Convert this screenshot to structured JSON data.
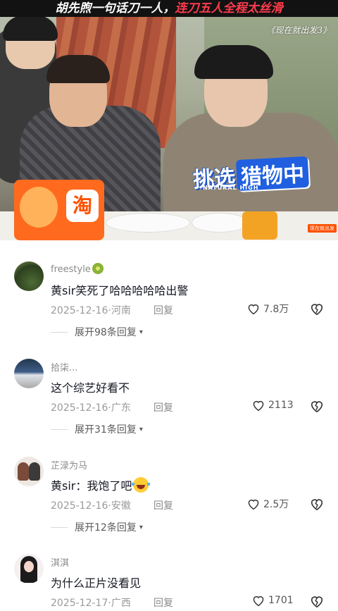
{
  "video": {
    "title_part1": "胡先煦一句话刀一人，",
    "title_part2": "连刀五人全程太丝滑",
    "show_tag": "《现在就出发3》",
    "caption_part1": "挑选",
    "caption_part2": "猎物中",
    "caption_sub": "NATURAL HIGH",
    "taobao_glyph": "淘",
    "corner_logo": "现在就出发",
    "colors": {
      "title_highlight": "#ff3c4c",
      "caption_blue": "#1f5fe0",
      "taobao_orange": "#ff6a1e"
    }
  },
  "comments": [
    {
      "username": "freestyle",
      "username_emoji": "kiwi-emoji",
      "text": "黄sir笑死了哈哈哈哈哈出警",
      "date": "2025-12-16",
      "location": "河南",
      "reply_label": "回复",
      "likes": "7.8万",
      "expand_label": "展开98条回复"
    },
    {
      "username": "拾柒...",
      "text": "这个综艺好看不",
      "date": "2025-12-16",
      "location": "广东",
      "reply_label": "回复",
      "likes": "2113",
      "expand_label": "展开31条回复"
    },
    {
      "username": "芷渌为马",
      "text": "黄sir：我饱了吧",
      "text_emoji": "tears-of-joy-emoji",
      "date": "2025-12-16",
      "location": "安徽",
      "reply_label": "回复",
      "likes": "2.5万",
      "expand_label": "展开12条回复"
    },
    {
      "username": "淇淇",
      "text": "为什么正片没看见",
      "date": "2025-12-17",
      "location": "广西",
      "reply_label": "回复",
      "likes": "1701"
    }
  ]
}
